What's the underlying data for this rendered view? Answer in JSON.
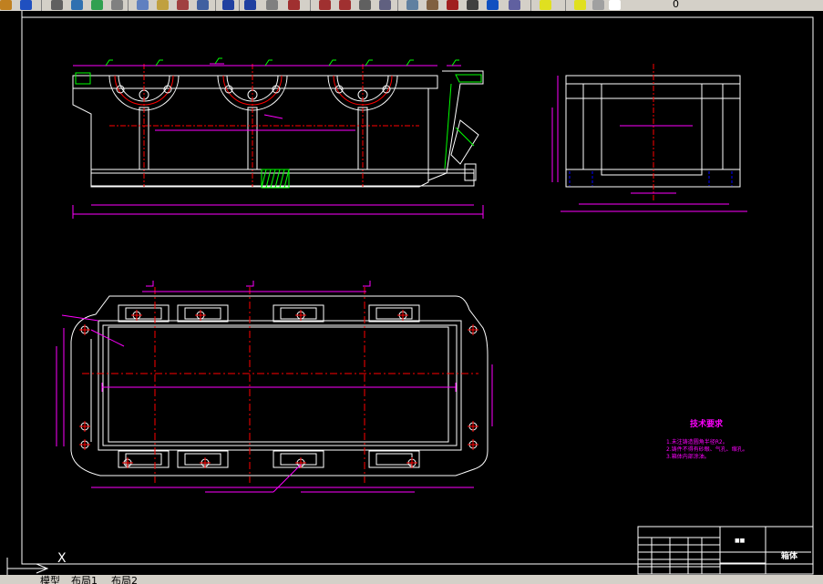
{
  "toolbar": {
    "buttons": [
      "new-icon",
      "save-icon",
      "print-icon",
      "preview-icon",
      "publish-icon",
      "cut-icon",
      "copy-icon",
      "paste-icon",
      "match-properties-icon",
      "block-editor-icon",
      "undo-icon",
      "redo-icon",
      "pan-icon",
      "zoom-realtime-icon",
      "zoom-window-icon",
      "zoom-previous-icon",
      "properties-icon",
      "designcenter-icon",
      "tool-palettes-icon",
      "sheetset-icon",
      "markup-icon",
      "calculator-icon",
      "help-icon",
      "layers-icon",
      "layer-on-icon",
      "layer-freeze-icon",
      "layer-lock-icon",
      "layer-color-icon"
    ],
    "layer_value": "0"
  },
  "tabs": {
    "model": "模型",
    "layout1": "布局1",
    "layout2": "布局2"
  },
  "ucs": {
    "x_label": "X"
  },
  "drawing": {
    "tech_title": "技术要求",
    "tech_items": [
      "1.未注铸造圆角半径R2。",
      "2.铸件不得有砂眼、气孔、缩孔。",
      "3.箱体内部涂油。"
    ],
    "title_block_name": "箱体",
    "title_block_code": "■■"
  },
  "colors": {
    "background": "#000000",
    "geometry": "#ffffff",
    "dimension": "#ff00ff",
    "centerline": "#ff0000",
    "hidden": "#00ffff",
    "section": "#00ff00",
    "highlight": "#ffff00",
    "blue": "#0000ff"
  }
}
